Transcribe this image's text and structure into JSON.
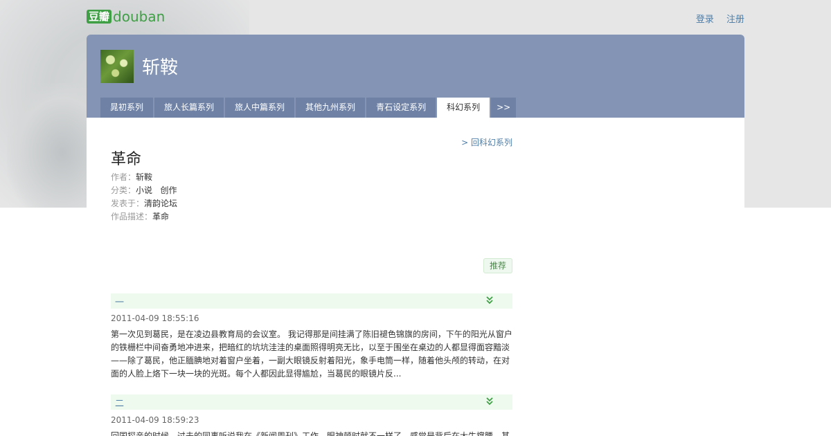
{
  "logo": {
    "cn": "豆瓣",
    "en": "douban"
  },
  "top_links": {
    "login": "登录",
    "register": "注册"
  },
  "header": {
    "author": "斩鞍",
    "tabs": [
      "晁初系列",
      "旅人长篇系列",
      "旅人中篇系列",
      "其他九州系列",
      "青石设定系列",
      "科幻系列",
      ">>"
    ],
    "active_tab": "科幻系列"
  },
  "back_link": "> 回科幻系列",
  "work": {
    "title": "革命",
    "author_label": "作者：",
    "author": "斩鞍",
    "category_label": "分类：",
    "category": "小说   创作",
    "published_label": "发表于：",
    "published": "清韵论坛",
    "desc_label": "作品描述：",
    "desc": "革命"
  },
  "recommend_label": "推荐",
  "chapters": [
    {
      "name": "一",
      "time": "2011-04-09 18:55:16",
      "excerpt": "第一次见到葛民，是在凌边县教育局的会议室。 我记得那是间挂满了陈旧褪色锦旗的房间，下午的阳光从窗户的铁栅栏中间奋勇地冲进来，把暗红的坑坑洼洼的桌面照得明亮无比，以至于围坐在桌边的人都显得面容黯淡——除了葛民，他正腼腆地对着窗户坐着，一副大眼镜反射着阳光，象手电筒一样，随着他头颅的转动，在对面的人脸上烙下一块一块的光斑。每个人都因此显得尴尬，当葛民的眼镜片反..."
    },
    {
      "name": "二",
      "time": "2011-04-09 18:59:23",
      "excerpt": "回国探亲的时候，过去的同事听说我在《新闻周刊》工作，眼神顿时就不一样了。感觉是背后在大牛撑腰，其"
    }
  ],
  "colors": {
    "header_bg": "#8394b4",
    "tab_bg": "#6f82a5",
    "link": "#4f7ea8",
    "chapter_bg": "#eefaee",
    "douban_green": "#3f9f45"
  },
  "icons": {
    "chapter_toggle": "double-chevron-down-icon"
  }
}
